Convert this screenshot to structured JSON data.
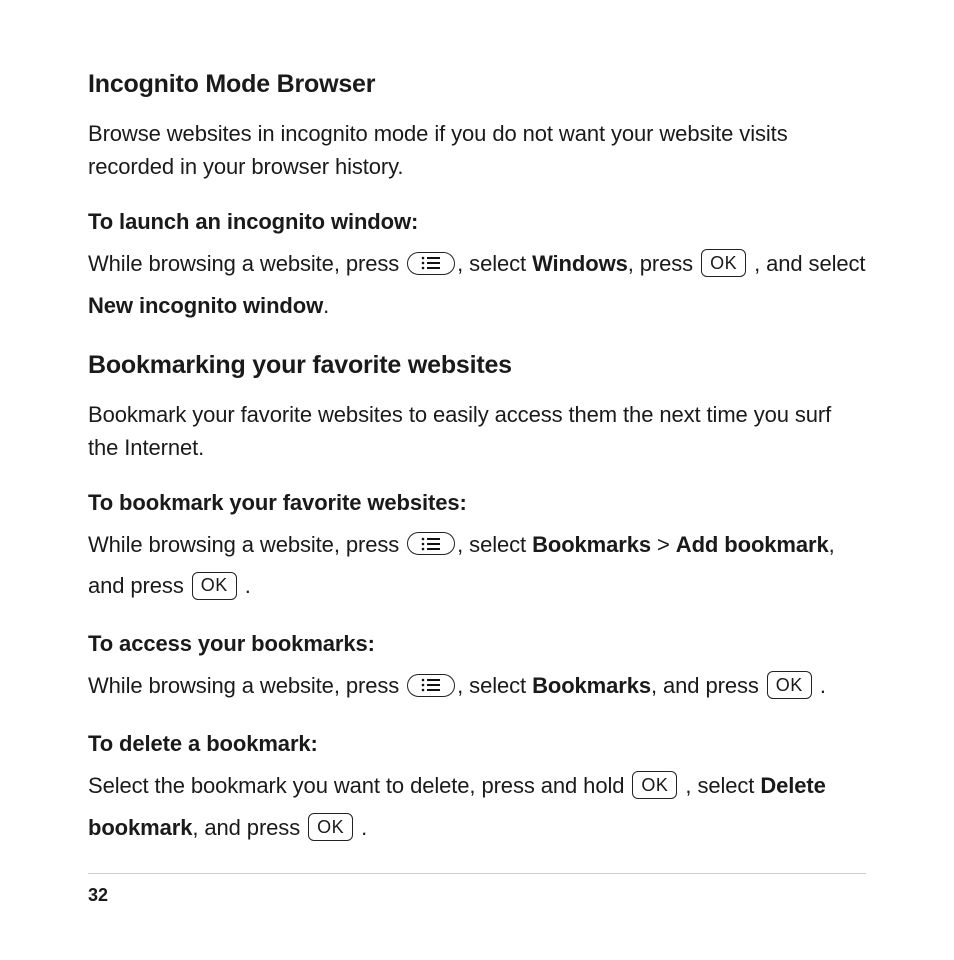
{
  "buttons": {
    "ok": "OK"
  },
  "section1": {
    "heading": "Incognito Mode Browser",
    "intro": "Browse websites in incognito mode if you do not want your website visits recorded in your browser history.",
    "sub1": {
      "heading": "To launch an incognito window:",
      "t1": "While browsing a website, press ",
      "t2": ", select ",
      "b1": "Windows",
      "t3": ", press ",
      "t4": ", and select ",
      "b2": "New incognito window",
      "t5": "."
    }
  },
  "section2": {
    "heading": "Bookmarking your favorite websites",
    "intro": "Bookmark your favorite websites to easily access them the next time you surf the Internet.",
    "sub1": {
      "heading": "To bookmark your favorite websites:",
      "t1": "While browsing a website, press ",
      "t2": ", select ",
      "b1": "Bookmarks",
      "t3": " > ",
      "b2": "Add bookmark",
      "t4": ", and press ",
      "t5": "."
    },
    "sub2": {
      "heading": "To access your bookmarks:",
      "t1": "While browsing a website, press ",
      "t2": ", select ",
      "b1": "Bookmarks",
      "t3": ", and press ",
      "t4": "."
    },
    "sub3": {
      "heading": "To delete a bookmark:",
      "t1": "Select the bookmark you want to delete, press and hold ",
      "t2": ", select ",
      "b1": "Delete bookmark",
      "t3": ", and press ",
      "t4": "."
    }
  },
  "pageNumber": "32"
}
